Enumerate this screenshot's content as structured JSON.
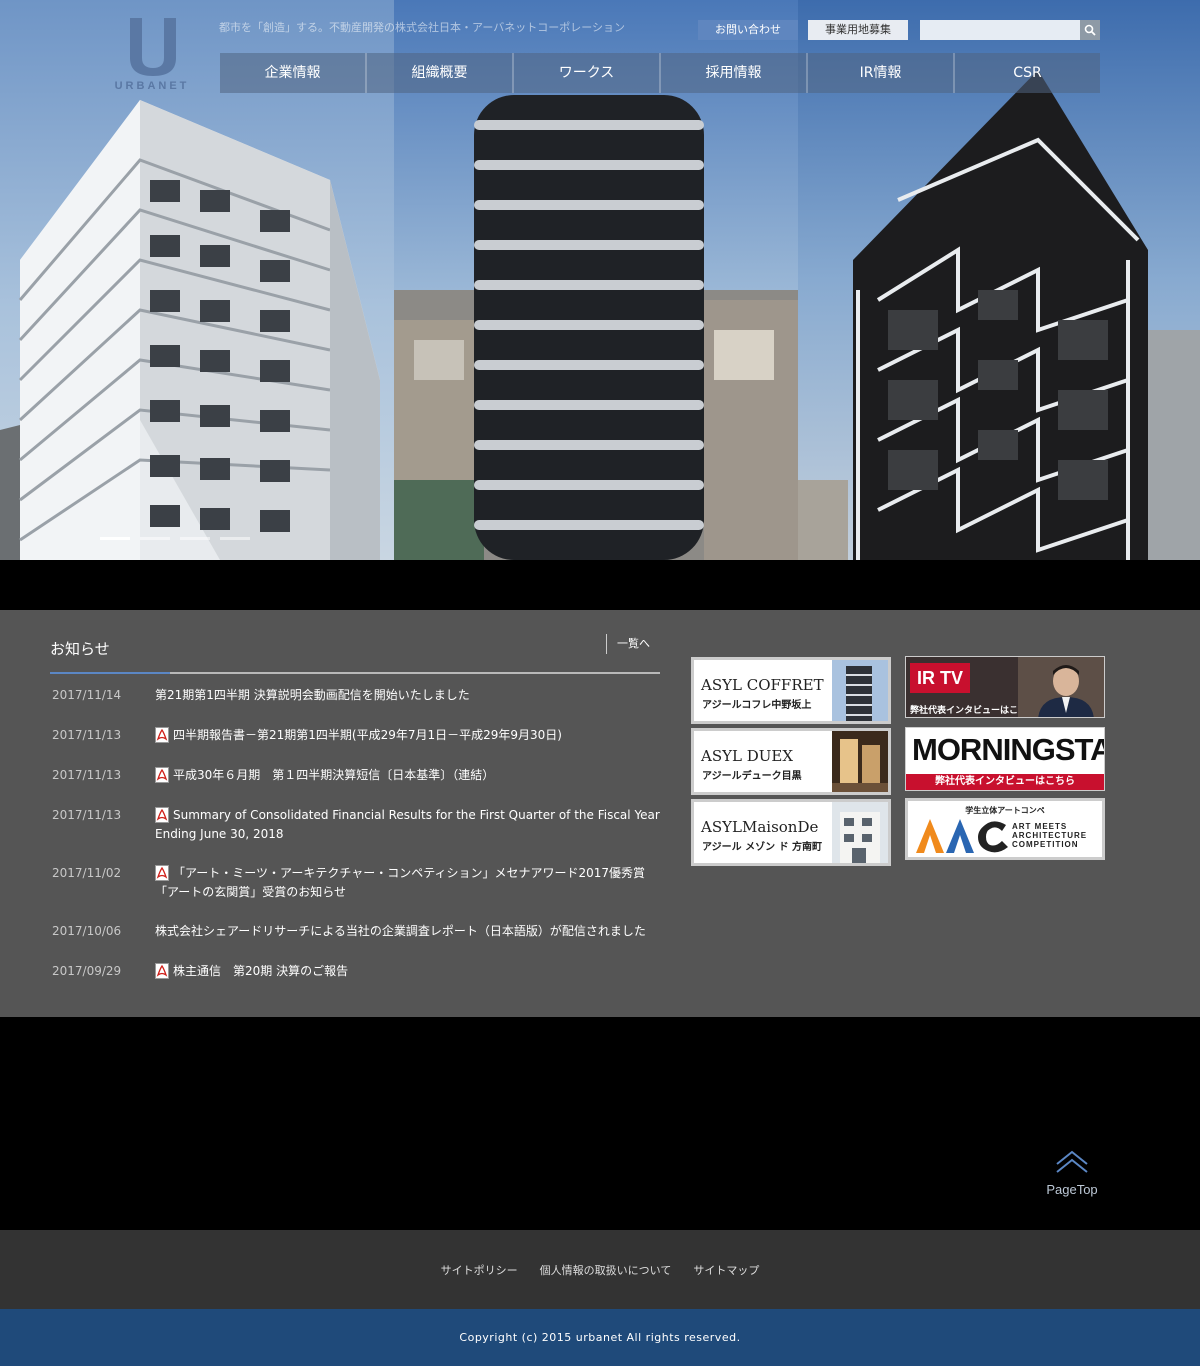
{
  "header": {
    "logo_text": "URBANET",
    "tagline": "都市を「創造」する。不動産開発の株式会社日本・アーバネットコーポレーション",
    "contact_label": "お問い合わせ",
    "land_label": "事業用地募集",
    "search_placeholder": ""
  },
  "nav": {
    "items": [
      {
        "label": "企業情報"
      },
      {
        "label": "組織概要"
      },
      {
        "label": "ワークス"
      },
      {
        "label": "採用情報"
      },
      {
        "label": "IR情報"
      },
      {
        "label": "CSR"
      }
    ]
  },
  "slider": {
    "count": 4,
    "active": 0
  },
  "news": {
    "title": "お知らせ",
    "more_label": "一覧へ",
    "items": [
      {
        "date": "2017/11/14",
        "text": "第21期第1四半期 決算説明会動画配信を開始いたしました",
        "pdf": false
      },
      {
        "date": "2017/11/13",
        "text": "四半期報告書－第21期第1四半期(平成29年7月1日－平成29年9月30日)",
        "pdf": true
      },
      {
        "date": "2017/11/13",
        "text": "平成30年６月期　第１四半期決算短信〔日本基準〕（連結）",
        "pdf": true
      },
      {
        "date": "2017/11/13",
        "text": "Summary of Consolidated Financial Results for the First Quarter of the Fiscal Year Ending June 30, 2018",
        "pdf": true
      },
      {
        "date": "2017/11/02",
        "text": "「アート・ミーツ・アーキテクチャー・コンペティション」メセナアワード2017優秀賞「アートの玄関賞」受賞のお知らせ",
        "pdf": true
      },
      {
        "date": "2017/10/06",
        "text": "株式会社シェアードリサーチによる当社の企業調査レポート（日本語版）が配信されました",
        "pdf": false
      },
      {
        "date": "2017/09/29",
        "text": "株主通信　第20期 決算のご報告",
        "pdf": true
      }
    ]
  },
  "banners": {
    "asyl_coffret": {
      "name": "ASYL COFFRET",
      "sub": "アジールコフレ中野坂上"
    },
    "asyl_duex": {
      "name": "ASYL DUEX",
      "sub": "アジールデューク目黒"
    },
    "asyl_maisonde": {
      "name": "ASYLMaisonDe",
      "sub": "アジール メゾン ド 方南町"
    },
    "irtv": {
      "logo": "IR TV",
      "sub": "弊社代表インタビューはこちら"
    },
    "morningstar": {
      "logo": "MORNINGSTAR",
      "sub": "弊社代表インタビューはこちら"
    },
    "aac": {
      "top": "学生立体アートコンペ",
      "words": [
        "ART MEETS",
        "ARCHITECTURE",
        "COMPETITION"
      ]
    }
  },
  "pagetop_label": "PageTop",
  "footer": {
    "links": [
      "サイトポリシー",
      "個人情報の取扱いについて",
      "サイトマップ"
    ],
    "copyright": "Copyright (c) 2015 urbanet All rights reserved."
  },
  "colors": {
    "accent": "#5b87c5",
    "content_bg": "#555555",
    "footer_nav_bg": "#333333",
    "copyright_bg": "#1f4a7a"
  }
}
